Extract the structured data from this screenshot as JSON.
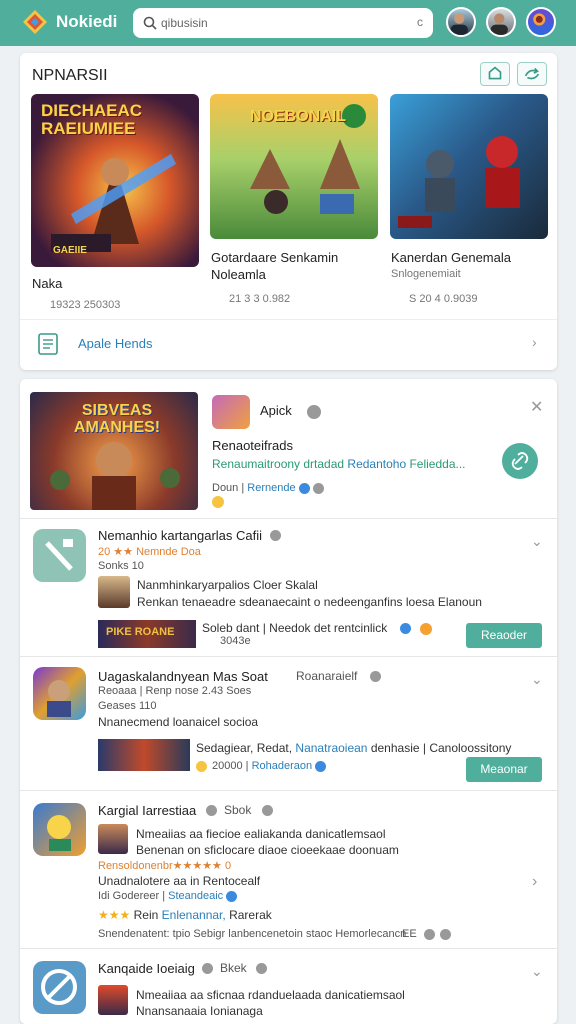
{
  "header": {
    "app_name": "Nokiedi",
    "search_value": "qibusisin",
    "clear_label": "c"
  },
  "featured_section": {
    "title": "NPNARSII",
    "games": [
      {
        "thumb_title": "DIECHAEAC RAEIUMIEE",
        "thumb_badge": "GAEIIE",
        "title": "Naka",
        "subtitle": "",
        "meta": "19323 250303"
      },
      {
        "thumb_title": "NOEBONAIL",
        "title": "Gotardaare Senkamin",
        "subtitle": "Noleamla",
        "meta": "21 3 3 0.982"
      },
      {
        "thumb_title": "",
        "thumb_badge": "",
        "title": "Kanerdan Genemala",
        "subtitle": "Snlogenemiait",
        "meta": "S 20 4 0.9039"
      }
    ],
    "footer_link": "Apale Hends"
  },
  "feature": {
    "thumb_title": "SIBVEAS AMANHES!",
    "app_name": "Apick",
    "title": "Renaoteifrads",
    "description_plain": "Renaumaitroony drtadad ",
    "description_link": "Redantoho",
    "description_end": " Feliedda...",
    "meta_a": "Doun",
    "meta_b": "Rernende"
  },
  "list": [
    {
      "title": "Nemanhio kartangarlas Cafii",
      "rating_row": "20 ★★  Nemnde Doa",
      "meta": "Sonks  10",
      "sub_title": "Nanmhinkaryarpalios Cloer Skalal",
      "sub_desc": "Renkan tenaeadre sdeanaecaint  o nedeenganfins loesa  Elanoun",
      "strip_label": "PIKE ROANE",
      "strip_caption": "Soleb dant  | Needok  det rentcinlick",
      "strip_meta": "3043e",
      "button": "Reaoder"
    },
    {
      "title": "Uagaskalandnyean Mas  Soat",
      "title_suffix": "Roanaraielf",
      "rating_row": "Reoaaa | Renp  nose 2.43  Soes",
      "meta": "Geases 110",
      "sub_desc": "Nnanecmend loanaicel socioa",
      "strip_caption_a": "Sedagiear, Redat,",
      "strip_caption_link": "Nanatraoiean",
      "strip_caption_b": "denhasie  | Canoloossitony",
      "strip_meta_a": "20000",
      "strip_meta_b": "Rohaderaon",
      "button": "Meaonar"
    },
    {
      "title": "Kargial Iarrestiaa",
      "title_suffix": "Sbok",
      "line1": "Nmeaiias aa fiecioe ealiakanda danicatlemsaol",
      "line2": "Benenan on sficlocare diaoe cioeekaae doonuam",
      "line3": "Rensoldonenbr★★★★★ 0",
      "line4": "Unadnalotere aa  in  Rentocealf",
      "line5_a": "Idi Godereer |",
      "line5_link": "Steandeaic",
      "stars_row_a": "Rein",
      "stars_row_link": "Enlenannar,",
      "stars_row_b": "Rarerak",
      "line6": "Snendenatent: tpio Sebigr  lanbencenetoin staoc  Hemorlecancn",
      "line6_meta": "EE"
    },
    {
      "title": "Kanqaide Ioeiaig",
      "title_suffix": "Bkek",
      "line1": "Nmeaiiaa aa sficnaa rdanduelaada danicatiemsaol",
      "line2": "Nnansanaaia Ionianaga"
    }
  ],
  "colors": {
    "primary": "#4fae9c",
    "link": "#2a7fb8"
  }
}
